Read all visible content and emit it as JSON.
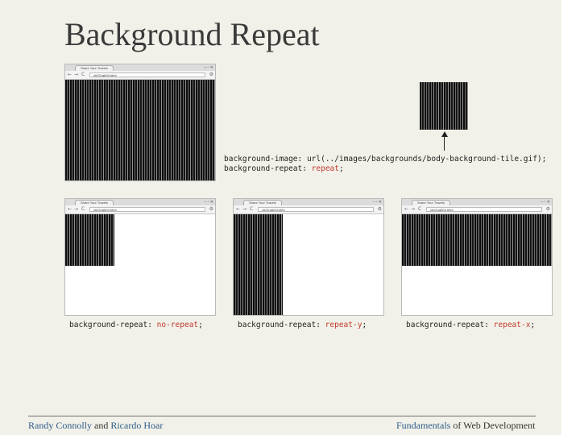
{
  "slide": {
    "title": "Background Repeat"
  },
  "browser": {
    "tab_label": "Share Your Travels",
    "url": "ch03-lab04.html",
    "nav": {
      "back": "←",
      "forward": "→",
      "reload": "C",
      "wrench": "⚙",
      "window_controls": "– ▫ ✕"
    }
  },
  "code_main": {
    "line1_prop": "background-image: url(../images/backgrounds/body-background-tile.gif);",
    "line2_prop": "background-repeat: ",
    "line2_val": "repeat",
    "line2_end": ";"
  },
  "captions": {
    "no_repeat": {
      "prop": "background-repeat: ",
      "val": "no-repeat",
      "end": ";"
    },
    "repeat_y": {
      "prop": "background-repeat: ",
      "val": "repeat-y",
      "end": ";"
    },
    "repeat_x": {
      "prop": "background-repeat: ",
      "val": "repeat-x",
      "end": ";"
    }
  },
  "footer": {
    "author1": "Randy Connolly",
    "and": " and ",
    "author2": "Ricardo Hoar",
    "book_accent": "Fundamentals",
    "book_rest": " of Web Development"
  },
  "colors": {
    "background": "#f2f1e9",
    "code_value": "#c0392b",
    "footer_accent": "#2e5c8a"
  }
}
